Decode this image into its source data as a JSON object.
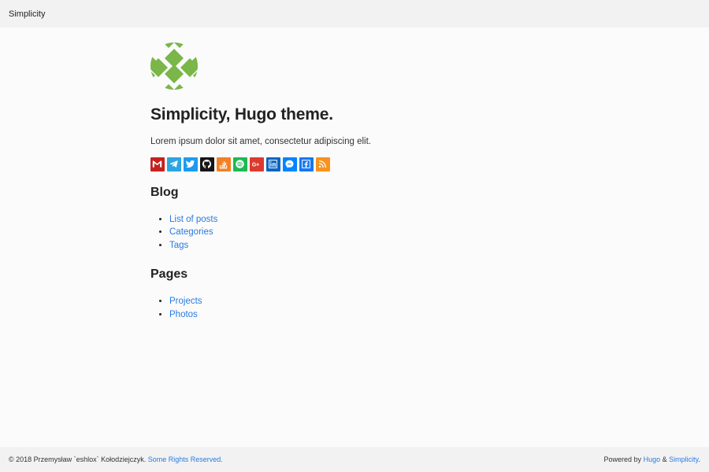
{
  "navbar": {
    "brand": "Simplicity"
  },
  "main": {
    "title": "Simplicity, Hugo theme.",
    "lead": "Lorem ipsum dolor sit amet, consectetur adipiscing elit.",
    "social": [
      {
        "icon": "gmail-icon",
        "color": "#c5221f"
      },
      {
        "icon": "telegram-icon",
        "color": "#2ca5e0"
      },
      {
        "icon": "twitter-icon",
        "color": "#1d9bf0"
      },
      {
        "icon": "github-icon",
        "color": "#171515"
      },
      {
        "icon": "stackoverflow-icon",
        "color": "#f48024"
      },
      {
        "icon": "spotify-icon",
        "color": "#1db954"
      },
      {
        "icon": "googleplus-icon",
        "color": "#dc3a2e"
      },
      {
        "icon": "linkedin-icon",
        "color": "#0a66c2"
      },
      {
        "icon": "messenger-icon",
        "color": "#0084ff"
      },
      {
        "icon": "facebook-icon",
        "color": "#1877f2"
      },
      {
        "icon": "rss-icon",
        "color": "#f7931e"
      }
    ],
    "blog": {
      "heading": "Blog",
      "links": [
        "List of posts",
        "Categories",
        "Tags"
      ]
    },
    "pages": {
      "heading": "Pages",
      "links": [
        "Projects",
        "Photos"
      ]
    }
  },
  "footer": {
    "copyright": "© 2018 Przemysław `eshlox` Kołodziejczyk.",
    "rights": "Some Rights Reserved.",
    "powered_prefix": "Powered by",
    "hugo": "Hugo",
    "amp": "&",
    "simplicity": "Simplicity",
    "period": "."
  },
  "colors": {
    "link": "#2a7ae2",
    "logo": "#7ab648",
    "nav_bg": "#f2f2f2"
  }
}
